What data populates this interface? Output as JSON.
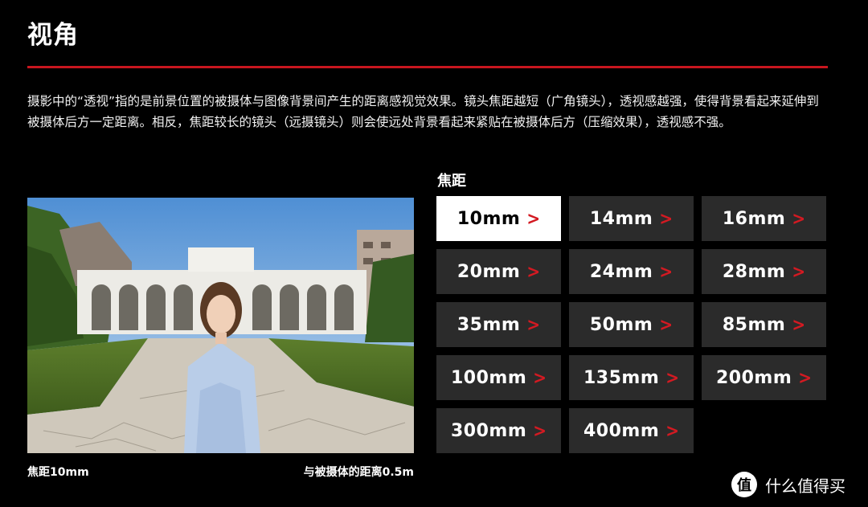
{
  "section": {
    "title": "视角",
    "accent_color": "#c8161e",
    "description": "摄影中的“透视”指的是前景位置的被摄体与图像背景间产生的距离感视觉效果。镜头焦距越短（广角镜头），透视感越强，使得背景看起来延伸到被摄体后方一定距离。相反，焦距较长的镜头（远摄镜头）则会使远处背景看起来紧贴在被摄体后方（压缩效果），透视感不强。"
  },
  "focal_selector": {
    "label": "焦距",
    "selected": "10mm",
    "chevron_icon": "chevron-right-icon",
    "options": [
      {
        "label": "10mm"
      },
      {
        "label": "14mm"
      },
      {
        "label": "16mm"
      },
      {
        "label": "20mm"
      },
      {
        "label": "24mm"
      },
      {
        "label": "28mm"
      },
      {
        "label": "35mm"
      },
      {
        "label": "50mm"
      },
      {
        "label": "85mm"
      },
      {
        "label": "100mm"
      },
      {
        "label": "135mm"
      },
      {
        "label": "200mm"
      },
      {
        "label": "300mm"
      },
      {
        "label": "400mm"
      }
    ]
  },
  "photo": {
    "caption_left": "焦距10mm",
    "caption_right": "与被摄体的距离0.5m"
  },
  "watermark": {
    "logo_glyph": "值",
    "text": "什么值得买"
  }
}
